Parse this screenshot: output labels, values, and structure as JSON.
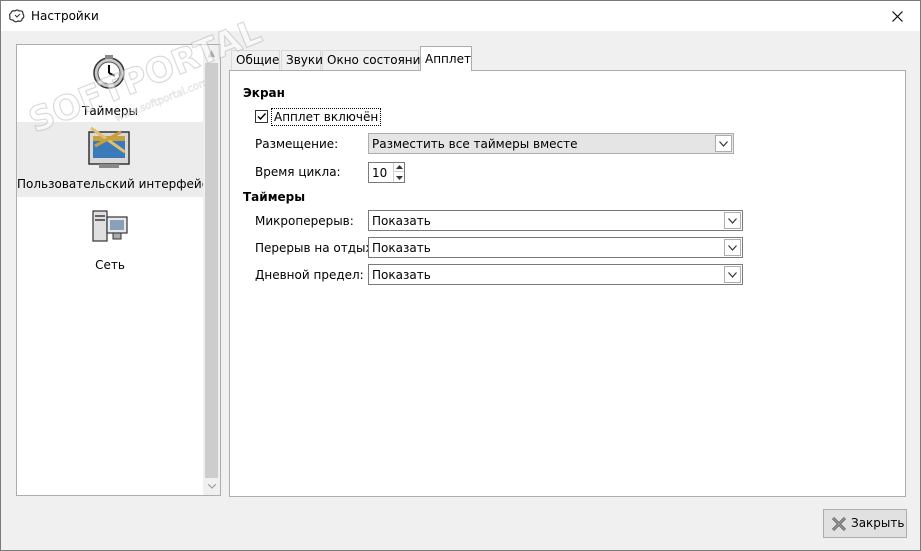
{
  "window": {
    "title": "Настройки"
  },
  "sidebar": {
    "items": [
      {
        "label": "Таймеры",
        "icon": "timers-icon"
      },
      {
        "label": "Пользовательский интерфейс",
        "icon": "user-interface-icon",
        "selected": true
      },
      {
        "label": "Сеть",
        "icon": "network-icon"
      }
    ]
  },
  "tabs": [
    {
      "label": "Общие"
    },
    {
      "label": "Звуки"
    },
    {
      "label": "Окно состояния"
    },
    {
      "label": "Апплет",
      "active": true
    }
  ],
  "applet": {
    "screen_section": "Экран",
    "applet_enabled_label": "Апплет включён",
    "applet_enabled": true,
    "placement_label": "Размещение:",
    "placement_value": "Разместить все таймеры вместе",
    "cycle_time_label": "Время цикла:",
    "cycle_time_value": "10",
    "timers_section": "Таймеры",
    "micro_label": "Микроперерыв:",
    "micro_value": "Показать",
    "rest_label": "Перерыв  на отдых:",
    "rest_value": "Показать",
    "daily_label": "Дневной предел:",
    "daily_value": "Показать"
  },
  "footer": {
    "close_label": "Закрыть"
  },
  "watermark": {
    "text": "SOFTPORTAL",
    "url": "www.softportal.com"
  }
}
